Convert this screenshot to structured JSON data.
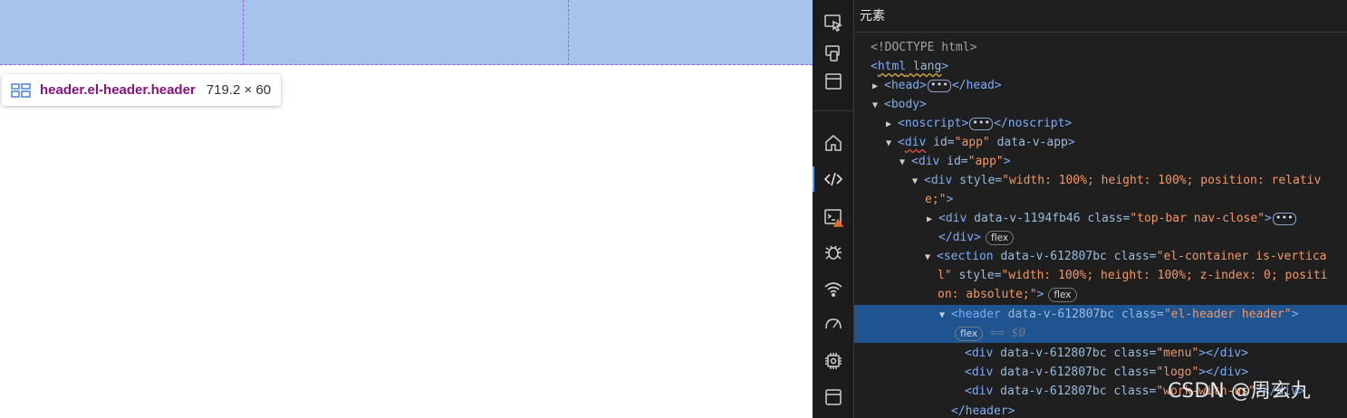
{
  "tooltip": {
    "selector": "header.el-header.header",
    "size": "719.2 × 60"
  },
  "devtools": {
    "panel_title": "元素",
    "activity_icons": [
      "inspect-icon",
      "device-toggle-icon",
      "window-icon",
      "home-icon",
      "elements-icon",
      "console-icon",
      "bug-icon",
      "network-wifi-icon",
      "performance-gauge-icon",
      "chip-icon",
      "application-window-icon"
    ],
    "accent": "#4a9df8",
    "selected_marker": "•••",
    "lines": [
      {
        "doctype": "<!DOCTYPE html>"
      },
      {
        "pre": "<",
        "tag": "html",
        "attrs": " lang",
        "post": ">"
      },
      {
        "tag_open": "<head>",
        "tag_close": "</head>"
      },
      {
        "tag_open": "<body>"
      },
      {
        "tag_open": "<noscript>",
        "tag_close": "</noscript>"
      },
      {
        "tag": "div",
        "attr1": " id=",
        "val1": "\"app\"",
        "attr2": " data-v-app",
        "post": ">"
      },
      {
        "tag": "div",
        "attr1": " id=",
        "val1": "\"app\"",
        "post": ">"
      },
      {
        "tag": "div",
        "attr1": " style=",
        "val1": "\"width: 100%; height: 100%; position: relativ"
      },
      {
        "val_cont": "e;\"",
        "post": ">"
      },
      {
        "tag": "div",
        "attr1": " data-v-1194fb46 class=",
        "val1": "\"top-bar nav-close\"",
        "post": ">"
      },
      {
        "tag_close": "</div>",
        "badge": "flex"
      },
      {
        "tag": "section",
        "attr1": " data-v-612807bc class=",
        "val1": "\"el-container is-vertica"
      },
      {
        "val_cont": "l\"",
        "attr2": " style=",
        "val2": "\"width: 100%; height: 100%; z-index: 0; positi"
      },
      {
        "val_cont": "on: absolute;\"",
        "post": ">",
        "badge": "flex"
      },
      {
        "tag": "header",
        "attr1": " data-v-612807bc class=",
        "val1": "\"el-header header\"",
        "post": ">"
      },
      {
        "badge": "flex",
        "dollar": "== $0"
      },
      {
        "tag": "div",
        "attr1": " data-v-612807bc class=",
        "val1": "\"menu\"",
        "post": ">",
        "tag_close": "</div>"
      },
      {
        "tag": "div",
        "attr1": " data-v-612807bc class=",
        "val1": "\"logo\"",
        "post": ">",
        "tag_close": "</div>"
      },
      {
        "tag": "div",
        "attr1": " data-v-612807bc class=",
        "val1": "\"work-with-us\"",
        "post": ">",
        "tag_close": "</div>"
      },
      {
        "tag_close": "</header>"
      }
    ]
  },
  "watermark": "CSDN @周玄九"
}
